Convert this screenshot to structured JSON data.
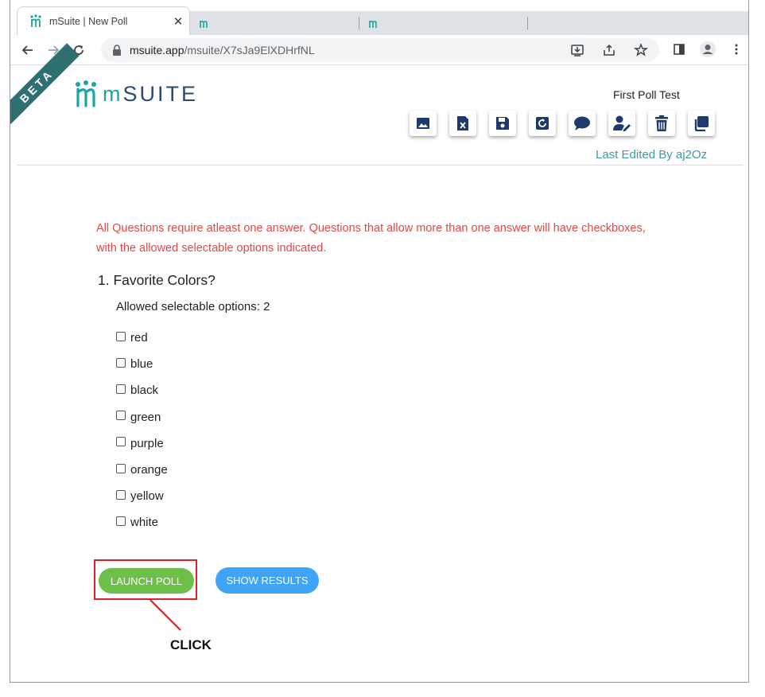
{
  "browser": {
    "tab_title": "mSuite | New Poll",
    "tab_close": "✕",
    "url_host": "msuite.app",
    "url_path": "/msuite/X7sJa9ElXDHrfNL"
  },
  "app": {
    "beta_label": "BETA",
    "logo_m": "m",
    "logo_rest": "SUITE",
    "poll_name": "First Poll Test",
    "last_edited": "Last Edited By aj2Oz",
    "action_icons": [
      "image-icon",
      "excel-icon",
      "save-icon",
      "restore-icon",
      "chat-icon",
      "edit-user-icon",
      "delete-icon",
      "copy-icon"
    ],
    "accent_color": "#3d9aa2",
    "navy_color": "#1e3a6a"
  },
  "poll": {
    "notice": "All Questions require atleast one answer. Questions that allow more than one answer will have checkboxes, with the allowed selectable options indicated.",
    "question": "1. Favorite Colors?",
    "allowed": "Allowed selectable options: 2",
    "options": [
      "red",
      "blue",
      "black",
      "green",
      "purple",
      "orange",
      "yellow",
      "white"
    ]
  },
  "buttons": {
    "launch": "LAUNCH POLL",
    "results": "SHOW RESULTS",
    "launch_color": "#6cc04a",
    "results_color": "#3ea4f7"
  },
  "annotation": {
    "label": "CLICK",
    "color": "#d9232d"
  }
}
